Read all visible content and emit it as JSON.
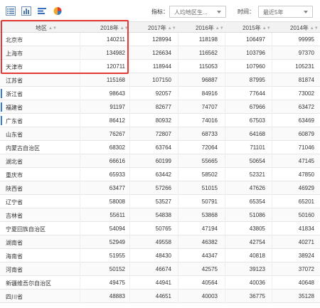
{
  "toolbar": {
    "icons": [
      "list-view-icon",
      "bar-chart-icon",
      "horizontal-bar-icon",
      "pie-chart-icon"
    ],
    "indicator_label": "指标：",
    "indicator_value": "人均地区生...",
    "time_label": "时间：",
    "time_value": "最近5年"
  },
  "table": {
    "columns": [
      "地区",
      "2018年",
      "2017年",
      "2016年",
      "2015年",
      "2014年"
    ],
    "rows": [
      {
        "region": "北京市",
        "values": [
          "140211",
          "128994",
          "118198",
          "106497",
          "99995"
        ]
      },
      {
        "region": "上海市",
        "values": [
          "134982",
          "126634",
          "116562",
          "103796",
          "97370"
        ]
      },
      {
        "region": "天津市",
        "values": [
          "120711",
          "118944",
          "115053",
          "107960",
          "105231"
        ]
      },
      {
        "region": "江苏省",
        "values": [
          "115168",
          "107150",
          "96887",
          "87995",
          "81874"
        ]
      },
      {
        "region": "浙江省",
        "values": [
          "98643",
          "92057",
          "84916",
          "77644",
          "73002"
        ]
      },
      {
        "region": "福建省",
        "values": [
          "91197",
          "82677",
          "74707",
          "67966",
          "63472"
        ]
      },
      {
        "region": "广东省",
        "values": [
          "86412",
          "80932",
          "74016",
          "67503",
          "63469"
        ]
      },
      {
        "region": "山东省",
        "values": [
          "76267",
          "72807",
          "68733",
          "64168",
          "60879"
        ]
      },
      {
        "region": "内蒙古自治区",
        "values": [
          "68302",
          "63764",
          "72064",
          "71101",
          "71046"
        ]
      },
      {
        "region": "湖北省",
        "values": [
          "66616",
          "60199",
          "55665",
          "50654",
          "47145"
        ]
      },
      {
        "region": "重庆市",
        "values": [
          "65933",
          "63442",
          "58502",
          "52321",
          "47850"
        ]
      },
      {
        "region": "陕西省",
        "values": [
          "63477",
          "57266",
          "51015",
          "47626",
          "46929"
        ]
      },
      {
        "region": "辽宁省",
        "values": [
          "58008",
          "53527",
          "50791",
          "65354",
          "65201"
        ]
      },
      {
        "region": "吉林省",
        "values": [
          "55611",
          "54838",
          "53868",
          "51086",
          "50160"
        ]
      },
      {
        "region": "宁夏回族自治区",
        "values": [
          "54094",
          "50765",
          "47194",
          "43805",
          "41834"
        ]
      },
      {
        "region": "湖南省",
        "values": [
          "52949",
          "49558",
          "46382",
          "42754",
          "40271"
        ]
      },
      {
        "region": "海南省",
        "values": [
          "51955",
          "48430",
          "44347",
          "40818",
          "38924"
        ]
      },
      {
        "region": "河南省",
        "values": [
          "50152",
          "46674",
          "42575",
          "39123",
          "37072"
        ]
      },
      {
        "region": "新疆维吾尔自治区",
        "values": [
          "49475",
          "44941",
          "40564",
          "40036",
          "40648"
        ]
      },
      {
        "region": "四川省",
        "values": [
          "48883",
          "44651",
          "40003",
          "36775",
          "35128"
        ]
      }
    ]
  },
  "colors": {
    "highlight": "#e53935",
    "accent": "#3a7bd5",
    "header_bg": "#f2f2f2"
  }
}
